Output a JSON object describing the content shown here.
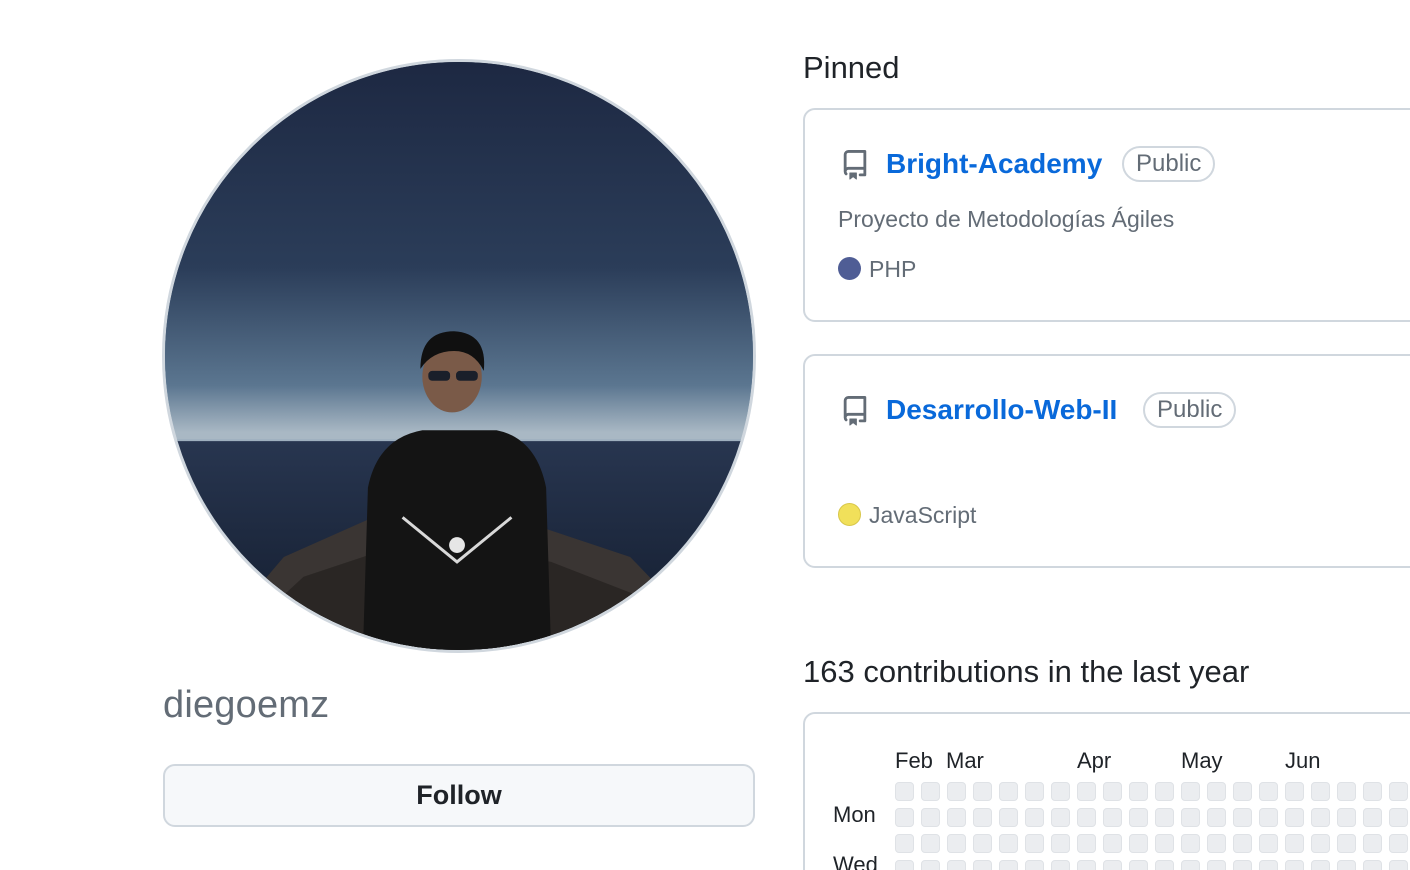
{
  "profile": {
    "username": "diegoemz",
    "follow_label": "Follow"
  },
  "pinned": {
    "title": "Pinned",
    "repos": [
      {
        "name": "Bright-Academy",
        "visibility": "Public",
        "description": "Proyecto de Metodologías Ágiles",
        "language": "PHP",
        "language_color": "#4F5D95"
      },
      {
        "name": "Desarrollo-Web-II",
        "visibility": "Public",
        "description": "",
        "language": "JavaScript",
        "language_color": "#f1e05a"
      }
    ]
  },
  "contributions": {
    "title": "163 contributions in the last year",
    "months": [
      "Feb",
      "Mar",
      "Apr",
      "May",
      "Jun"
    ],
    "day_labels": [
      "Mon",
      "Wed"
    ],
    "empty_cell_color": "#ebedf0"
  },
  "icons": {
    "repo": "repo-icon"
  }
}
